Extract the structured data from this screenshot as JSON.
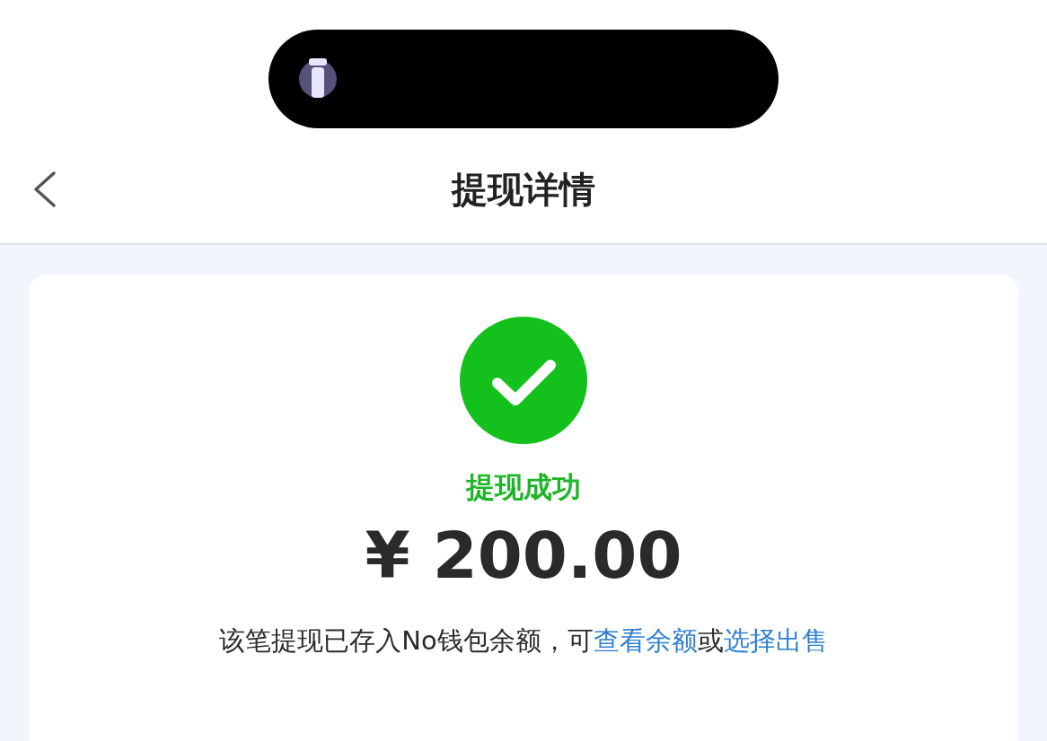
{
  "header": {
    "title": "提现详情"
  },
  "result": {
    "success": true,
    "title": "提现成功",
    "amount": "¥ 200.00",
    "note": {
      "text": "该笔提现已存入No钱包余额，可",
      "link_1": "查看余额",
      "middle": "或",
      "link_2": "选择出售"
    }
  }
}
